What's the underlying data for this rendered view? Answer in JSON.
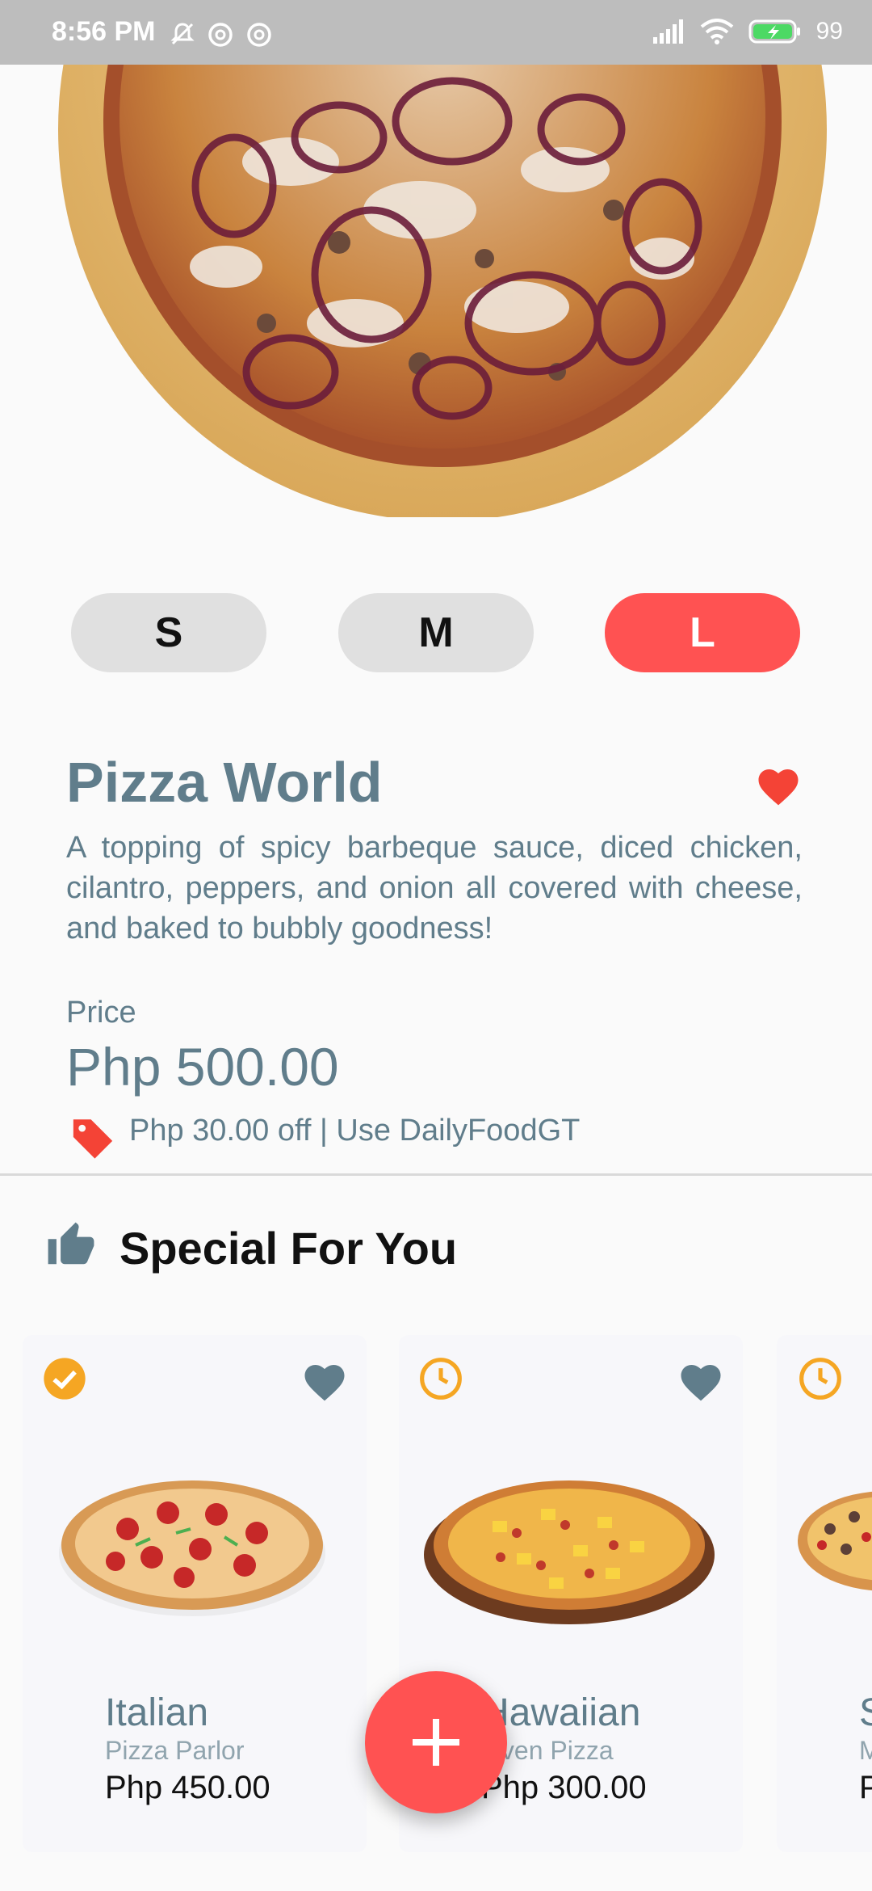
{
  "status_bar": {
    "time": "8:56 PM",
    "battery": "99"
  },
  "sizes": [
    {
      "label": "S"
    },
    {
      "label": "M"
    },
    {
      "label": "L"
    }
  ],
  "product": {
    "title": "Pizza World",
    "description": "A topping of spicy barbeque sauce, diced chicken, cilantro, peppers, and onion all covered with cheese, and baked to bubbly goodness!",
    "price_label": "Price",
    "price": "Php 500.00",
    "promo": "Php 30.00 off | Use DailyFoodGT"
  },
  "section": {
    "title": "Special For You"
  },
  "cards": [
    {
      "name": "Italian",
      "subtitle": "Pizza Parlor",
      "price": "Php 450.00",
      "status_icon": "check-circle-icon"
    },
    {
      "name": "Hawaiian",
      "subtitle": "Oven Pizza",
      "price": "Php 300.00",
      "status_icon": "clock-icon"
    },
    {
      "name": "S",
      "subtitle": "M",
      "price": "P",
      "status_icon": "clock-icon"
    }
  ],
  "colors": {
    "accent": "#ff5252",
    "slate": "#607d8b",
    "orange": "#f5a623"
  }
}
